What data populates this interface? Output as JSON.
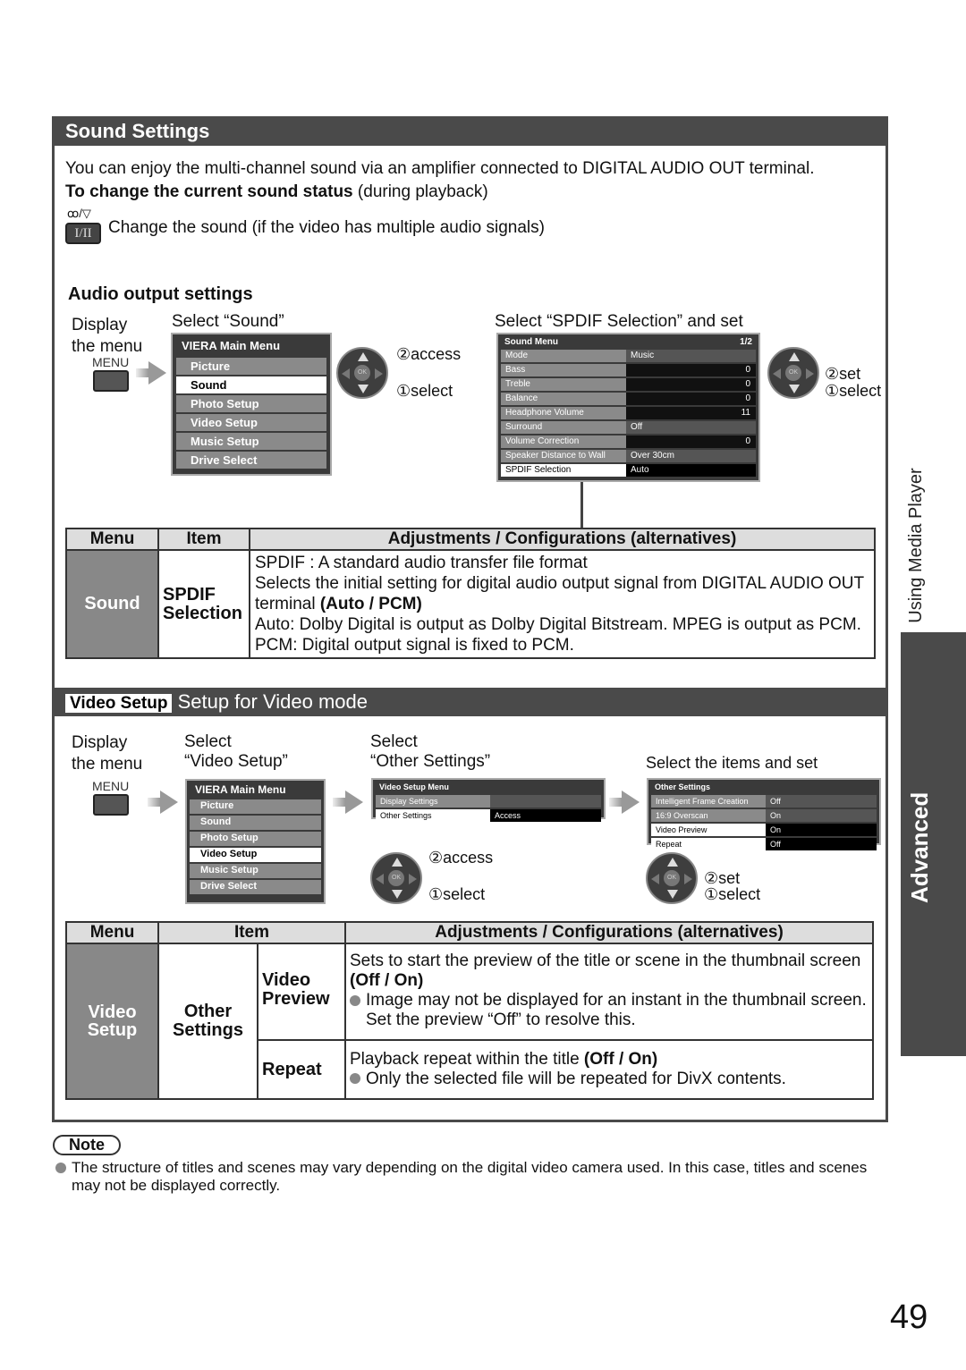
{
  "sound": {
    "header": "Sound Settings",
    "intro": "You can enjoy the multi-channel sound via an amplifier connected to DIGITAL AUDIO OUT terminal.",
    "change_title": "To change the current sound status",
    "change_suffix": "(during playback)",
    "button_symbol_top": "ꝏ/▽",
    "button_label": "I/II",
    "change_desc": "Change the sound (if the video has multiple audio signals)",
    "audio_output_title": "Audio output settings",
    "step1": "Display\nthe menu",
    "menu_label": "MENU",
    "step2": "Select “Sound”",
    "step3": "Select “SPDIF Selection” and set",
    "main_menu": {
      "title": "VIERA Main Menu",
      "items": [
        "Picture",
        "Sound",
        "Photo Setup",
        "Video Setup",
        "Music Setup",
        "Drive Select"
      ],
      "selected": 1
    },
    "access": "②access",
    "select": "①select",
    "set": "②set",
    "sound_menu": {
      "title": "Sound Menu",
      "page": "1/2",
      "rows": [
        {
          "k": "Mode",
          "v": "Music"
        },
        {
          "k": "Bass",
          "v": "0",
          "bar": true
        },
        {
          "k": "Treble",
          "v": "0",
          "bar": true
        },
        {
          "k": "Balance",
          "v": "0",
          "bar": true
        },
        {
          "k": "Headphone Volume",
          "v": "11",
          "bar": true
        },
        {
          "k": "Surround",
          "v": "Off"
        },
        {
          "k": "Volume Correction",
          "v": "0",
          "bar": true
        },
        {
          "k": "Speaker Distance to Wall",
          "v": "Over 30cm"
        },
        {
          "k": "SPDIF Selection",
          "v": "Auto",
          "sel": true
        }
      ]
    },
    "table": {
      "headers": [
        "Menu",
        "Item",
        "Adjustments / Configurations (alternatives)"
      ],
      "menu": "Sound",
      "item": "SPDIF\nSelection",
      "lines": [
        "SPDIF : A standard audio transfer file format",
        "Selects the initial setting for digital audio output signal from DIGITAL AUDIO OUT terminal",
        "(Auto / PCM)",
        "Auto: Dolby Digital is output as Dolby Digital Bitstream. MPEG is output as PCM.",
        "PCM: Digital output signal is fixed to PCM."
      ]
    }
  },
  "video": {
    "header_tag": "Video Setup",
    "header": "Setup for Video mode",
    "step1": "Display\nthe menu",
    "menu_label": "MENU",
    "step2": "Select\n“Video Setup”",
    "step3": "Select\n“Other Settings”",
    "step4": "Select the items and set",
    "main_menu": {
      "title": "VIERA Main Menu",
      "items": [
        "Picture",
        "Sound",
        "Photo Setup",
        "Video Setup",
        "Music Setup",
        "Drive Select"
      ],
      "selected": 3
    },
    "video_menu": {
      "title": "Video Setup Menu",
      "rows": [
        {
          "k": "Display Settings",
          "v": ""
        },
        {
          "k": "Other Settings",
          "v": "Access",
          "sel": true
        }
      ]
    },
    "other_menu": {
      "title": "Other Settings",
      "rows": [
        {
          "k": "Intelligent Frame Creation",
          "v": "Off"
        },
        {
          "k": "16:9 Overscan",
          "v": "On"
        },
        {
          "k": "Video Preview",
          "v": "On",
          "sel": true
        },
        {
          "k": "Repeat",
          "v": "Off",
          "sel": true
        }
      ]
    },
    "access": "②access",
    "select": "①select",
    "set": "②set",
    "table": {
      "headers": [
        "Menu",
        "Item",
        "Adjustments / Configurations (alternatives)"
      ],
      "menu": "Video\nSetup",
      "item": "Other\nSettings",
      "rows": [
        {
          "sub": "Video\nPreview",
          "text": "Sets to start the preview of the title or scene in the thumbnail screen",
          "opt": "(Off / On)",
          "bullet": "Image may not be displayed for an instant in the thumbnail screen. Set the preview “Off” to resolve this."
        },
        {
          "sub": "Repeat",
          "text": "Playback repeat within the title",
          "opt": "(Off / On)",
          "bullet": "Only the selected file will be repeated for DivX contents."
        }
      ]
    }
  },
  "side": {
    "tab_top": "Using Media Player",
    "tab_main": "Advanced"
  },
  "note": {
    "label": "Note",
    "text": "The structure of titles and scenes may vary depending on the digital video camera used. In this case, titles and scenes may not be displayed correctly."
  },
  "page_number": "49"
}
